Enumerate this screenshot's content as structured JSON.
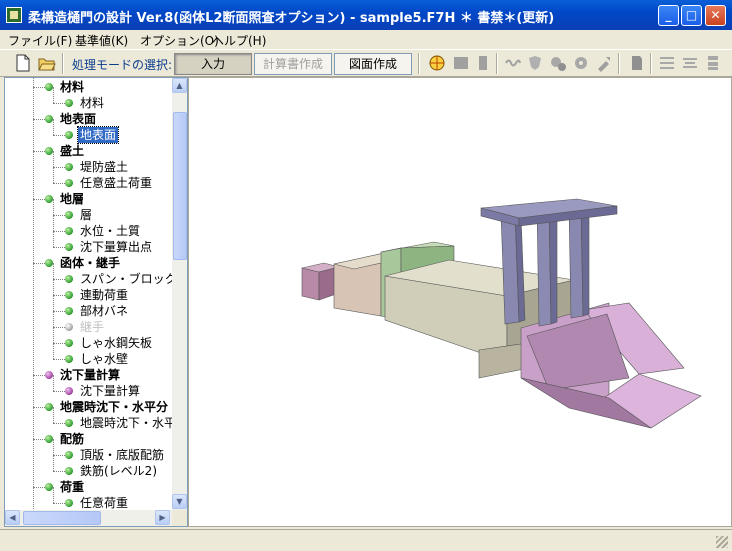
{
  "window": {
    "title": "柔構造樋門の設計 Ver.8(函体L2断面照査オプション) - sample5.F7H ＊ 書禁＊(更新)",
    "minimize_label": "_",
    "maximize_label": "□",
    "close_label": "✕"
  },
  "menu": {
    "items": [
      "ファイル(F)",
      "基準値(K)",
      "オプション(O)",
      "ヘルプ(H)"
    ]
  },
  "toolbar": {
    "mode_label": "処理モードの選択:",
    "mode_buttons": [
      "入力",
      "計算書作成",
      "図面作成"
    ],
    "active_mode": "入力",
    "disabled_mode": "計算書作成"
  },
  "tree": {
    "items": [
      {
        "label": "材料",
        "level": 0
      },
      {
        "label": "材料",
        "level": 1
      },
      {
        "label": "地表面",
        "level": 0
      },
      {
        "label": "地表面",
        "level": 1,
        "selected": true
      },
      {
        "label": "盛土",
        "level": 0
      },
      {
        "label": "堤防盛土",
        "level": 1
      },
      {
        "label": "任意盛土荷重",
        "level": 1
      },
      {
        "label": "地層",
        "level": 0
      },
      {
        "label": "層",
        "level": 1
      },
      {
        "label": "水位・土質",
        "level": 1
      },
      {
        "label": "沈下量算出点",
        "level": 1
      },
      {
        "label": "函体・継手",
        "level": 0
      },
      {
        "label": "スパン・ブロック",
        "level": 1
      },
      {
        "label": "連動荷重",
        "level": 1
      },
      {
        "label": "部材バネ",
        "level": 1
      },
      {
        "label": "継手",
        "level": 1,
        "disabled": true
      },
      {
        "label": "しゃ水鋼矢板",
        "level": 1
      },
      {
        "label": "しゃ水壁",
        "level": 1
      },
      {
        "label": "沈下量計算",
        "level": 0,
        "color": "purple"
      },
      {
        "label": "沈下量計算",
        "level": 1,
        "color": "purple"
      },
      {
        "label": "地震時沈下・水平分",
        "level": 0
      },
      {
        "label": "地震時沈下・水平:",
        "level": 1
      },
      {
        "label": "配筋",
        "level": 0
      },
      {
        "label": "頂版・底版配筋",
        "level": 1
      },
      {
        "label": "鉄筋(レベル2)",
        "level": 1
      },
      {
        "label": "荷重",
        "level": 0
      },
      {
        "label": "任意荷重",
        "level": 1
      }
    ]
  },
  "colors": {
    "titlebar": "#0a5fd8",
    "tree_selected": "#316ac5",
    "model_box": "#c8c8b4",
    "model_wing": "#c896c8",
    "model_pier": "#8c8cb4",
    "model_joint": "#a0c8a0"
  }
}
